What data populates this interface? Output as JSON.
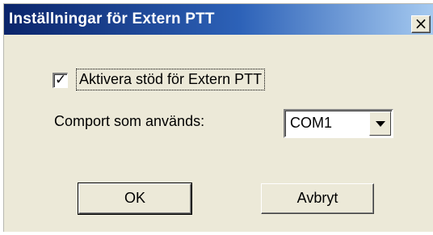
{
  "window": {
    "title": "Inställningar för Extern PTT",
    "close_glyph": "×"
  },
  "options": {
    "enable_checkbox": {
      "label": "Aktivera stöd för Extern PTT",
      "checked": true,
      "check_glyph": "✓"
    },
    "comport": {
      "label": "Comport som används:",
      "selected": "COM1"
    }
  },
  "buttons": {
    "ok_label": "OK",
    "cancel_label": "Avbryt"
  },
  "colors": {
    "titlebar_start": "#0a246a",
    "titlebar_end": "#a6caf0",
    "dialog_bg": "#ece9d8"
  },
  "icons": [
    "close-icon",
    "checkmark-icon",
    "dropdown-arrow-icon"
  ]
}
